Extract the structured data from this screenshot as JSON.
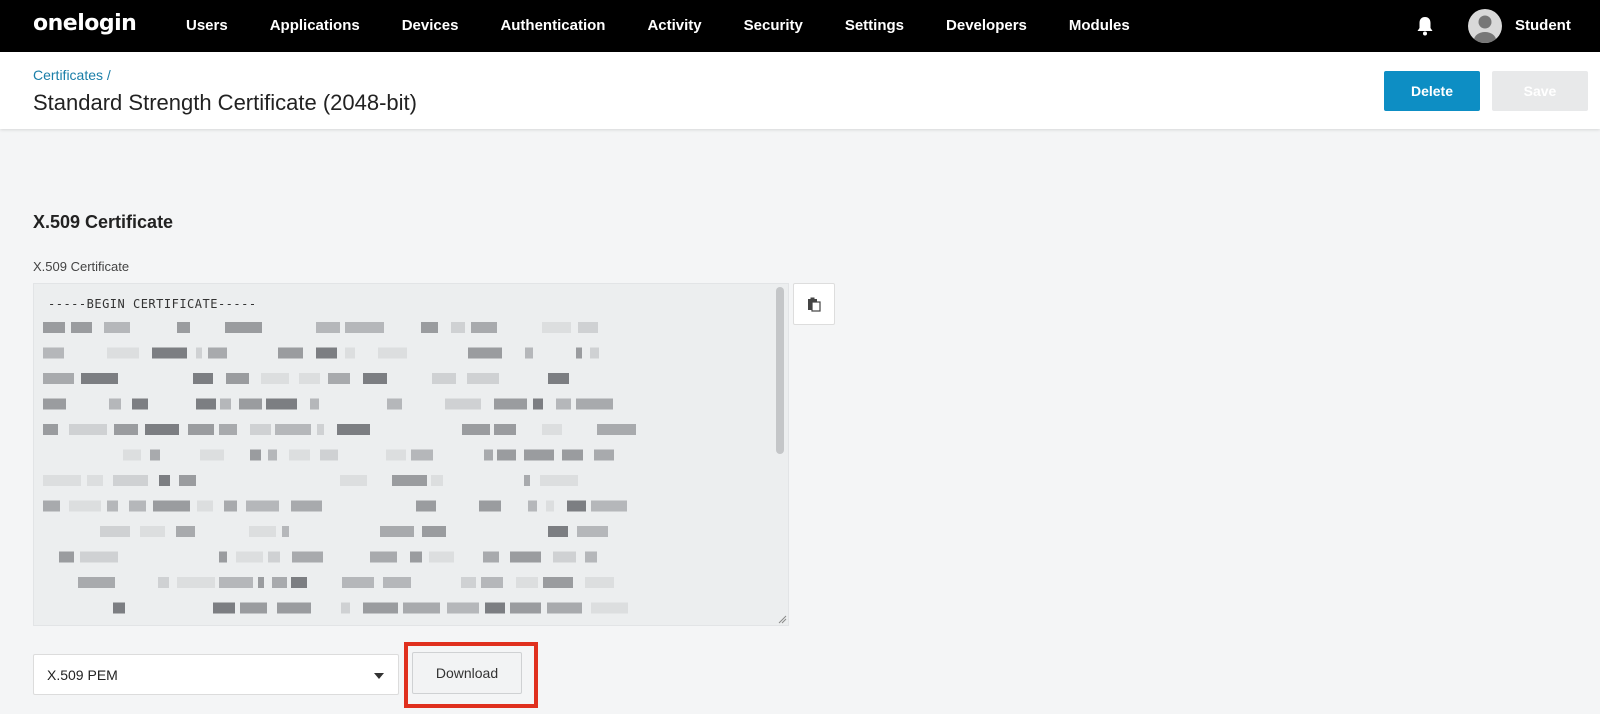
{
  "topbar": {
    "logo": "onelogin",
    "nav": [
      "Users",
      "Applications",
      "Devices",
      "Authentication",
      "Activity",
      "Security",
      "Settings",
      "Developers",
      "Modules"
    ],
    "user_name": "Student"
  },
  "header": {
    "breadcrumb": "Certificates /",
    "title": "Standard Strength Certificate (2048-bit)",
    "delete_label": "Delete",
    "save_label": "Save"
  },
  "certificate": {
    "section_title": "X.509 Certificate",
    "field_label": "X.509 Certificate",
    "begin_line": "-----BEGIN CERTIFICATE-----"
  },
  "download": {
    "format_value": "X.509 PEM",
    "download_label": "Download"
  },
  "colors": {
    "accent": "#0d8ec4",
    "highlight": "#e0301e"
  }
}
